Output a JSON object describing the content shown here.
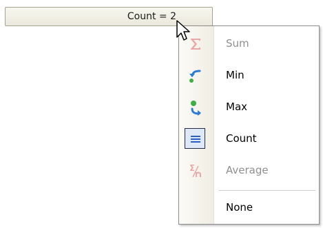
{
  "summary": {
    "text": "Count = 2"
  },
  "menu": {
    "items": [
      {
        "label": "Sum",
        "icon": "sigma-icon",
        "enabled": false,
        "checked": false
      },
      {
        "label": "Min",
        "icon": "min-arrow-icon",
        "enabled": true,
        "checked": false
      },
      {
        "label": "Max",
        "icon": "max-arrow-icon",
        "enabled": true,
        "checked": false
      },
      {
        "label": "Count",
        "icon": "count-lines-icon",
        "enabled": true,
        "checked": true
      },
      {
        "label": "Average",
        "icon": "average-icon",
        "enabled": false,
        "checked": false
      },
      {
        "label": "None",
        "icon": "",
        "enabled": true,
        "checked": false
      }
    ]
  },
  "colors": {
    "icon_blue": "#2a7bd6",
    "icon_green": "#3cb043",
    "disabled_text": "#8f8f8f",
    "sigma_disabled": "#e9a7a7"
  }
}
